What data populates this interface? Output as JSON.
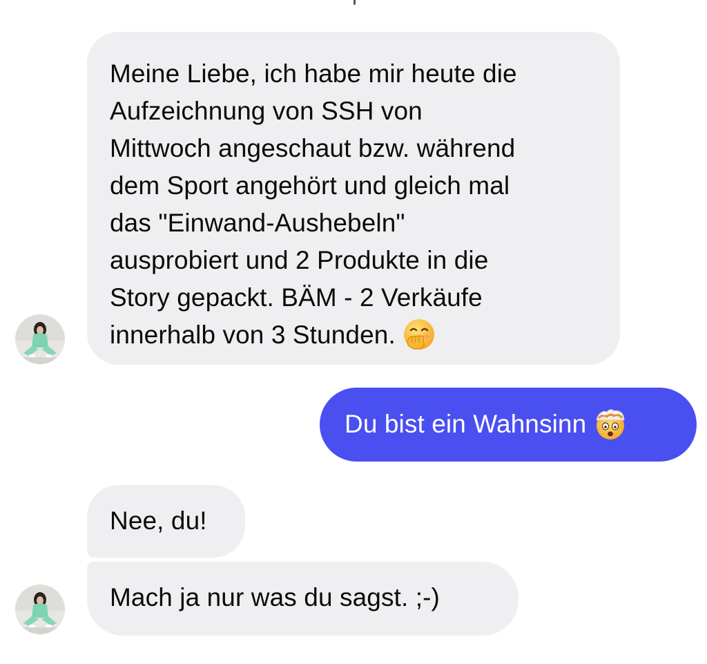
{
  "conversation": {
    "messages": [
      {
        "sender": "contact",
        "lines": [
          "Meine Liebe, ich habe mir heute die",
          "Aufzeichnung von SSH von",
          "Mittwoch angeschaut bzw. während",
          "dem Sport angehört und gleich mal",
          "das \"Einwand-Aushebeln\"",
          "ausprobiert und 2 Produkte in die",
          "Story gepackt. BÄM - 2 Verkäufe",
          "innerhalb von 3 Stunden."
        ],
        "emoji": "face-with-hand-over-mouth-emoji"
      },
      {
        "sender": "me",
        "text": "Du bist ein Wahnsinn",
        "emoji": "exploding-head-emoji"
      },
      {
        "sender": "contact",
        "text": "Nee, du!"
      },
      {
        "sender": "contact",
        "text": "Mach ja nur was du sagst. ;-)"
      }
    ]
  },
  "colors": {
    "incoming_bubble": "#efeff1",
    "outgoing_bubble": "#4a4ff0",
    "incoming_text": "#0b0b0b",
    "outgoing_text": "#ffffff"
  },
  "icons": {
    "avatar": "contact-avatar"
  }
}
